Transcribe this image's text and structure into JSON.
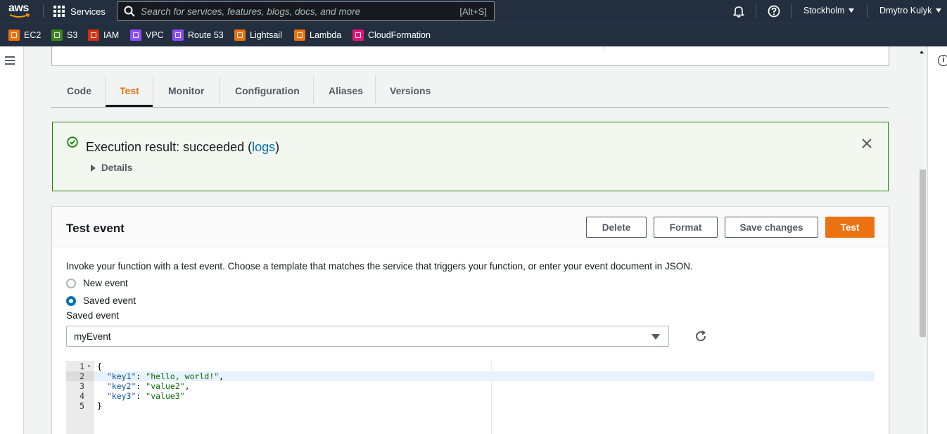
{
  "nav": {
    "logo": "aws",
    "services_label": "Services",
    "search_placeholder": "Search for services, features, blogs, docs, and more",
    "search_shortcut": "[Alt+S]",
    "region": "Stockholm",
    "user": "Dmytro Kulyk"
  },
  "favorites": [
    {
      "label": "EC2",
      "color": "#ec7211"
    },
    {
      "label": "S3",
      "color": "#3f8624"
    },
    {
      "label": "IAM",
      "color": "#d13212"
    },
    {
      "label": "VPC",
      "color": "#8c4fff"
    },
    {
      "label": "Route 53",
      "color": "#8c4fff"
    },
    {
      "label": "Lightsail",
      "color": "#ec7211"
    },
    {
      "label": "Lambda",
      "color": "#ec7211"
    },
    {
      "label": "CloudFormation",
      "color": "#e7157b"
    }
  ],
  "tabs": [
    {
      "label": "Code"
    },
    {
      "label": "Test"
    },
    {
      "label": "Monitor"
    },
    {
      "label": "Configuration"
    },
    {
      "label": "Aliases"
    },
    {
      "label": "Versions"
    }
  ],
  "alert": {
    "title_prefix": "Execution result: succeeded (",
    "link": "logs",
    "title_suffix": ")",
    "details_label": "Details"
  },
  "test_event": {
    "title": "Test event",
    "buttons": {
      "delete": "Delete",
      "format": "Format",
      "save": "Save changes",
      "test": "Test"
    },
    "description": "Invoke your function with a test event. Choose a template that matches the service that triggers your function, or enter your event document in JSON.",
    "radio_new": "New event",
    "radio_saved": "Saved event",
    "saved_event_label": "Saved event",
    "saved_event_value": "myEvent"
  },
  "editor": {
    "lines": [
      {
        "n": "1",
        "text": "{"
      },
      {
        "n": "2",
        "key": "\"key1\"",
        "value": "\"hello, world!\"",
        "trail": ","
      },
      {
        "n": "3",
        "key": "\"key2\"",
        "value": "\"value2\"",
        "trail": ","
      },
      {
        "n": "4",
        "key": "\"key3\"",
        "value": "\"value3\"",
        "trail": ""
      },
      {
        "n": "5",
        "text": "}"
      }
    ]
  }
}
